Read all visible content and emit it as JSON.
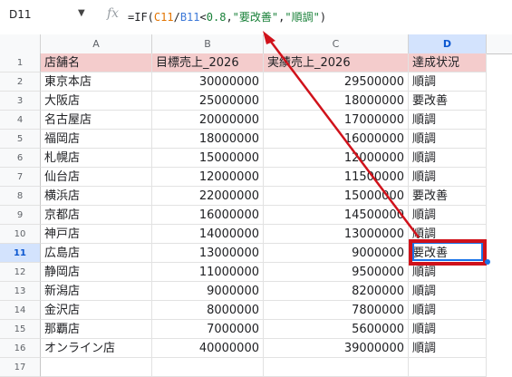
{
  "formula_bar": {
    "name_box": "D11",
    "fx": "fx",
    "f_eq": "=IF(",
    "f_ref1": "C11",
    "f_slash": "/",
    "f_ref2": "B11",
    "f_lt": "<",
    "f_num": "0.8",
    "f_c1": ",",
    "f_str1": "\"要改善\"",
    "f_c2": ",",
    "f_str2": "\"順調\"",
    "f_end": ")"
  },
  "columns": [
    "A",
    "B",
    "C",
    "D"
  ],
  "headers": [
    "店舗名",
    "目標売上_2026",
    "実績売上_2026",
    "達成状況"
  ],
  "rows": [
    {
      "n": "2",
      "store": "東京本店",
      "target": "30000000",
      "actual": "29500000",
      "status": "順調"
    },
    {
      "n": "3",
      "store": "大阪店",
      "target": "25000000",
      "actual": "18000000",
      "status": "要改善"
    },
    {
      "n": "4",
      "store": "名古屋店",
      "target": "20000000",
      "actual": "17000000",
      "status": "順調"
    },
    {
      "n": "5",
      "store": "福岡店",
      "target": "18000000",
      "actual": "16000000",
      "status": "順調"
    },
    {
      "n": "6",
      "store": "札幌店",
      "target": "15000000",
      "actual": "12000000",
      "status": "順調"
    },
    {
      "n": "7",
      "store": "仙台店",
      "target": "12000000",
      "actual": "11500000",
      "status": "順調"
    },
    {
      "n": "8",
      "store": "横浜店",
      "target": "22000000",
      "actual": "15000000",
      "status": "要改善"
    },
    {
      "n": "9",
      "store": "京都店",
      "target": "16000000",
      "actual": "14500000",
      "status": "順調"
    },
    {
      "n": "10",
      "store": "神戸店",
      "target": "14000000",
      "actual": "13000000",
      "status": "順調"
    },
    {
      "n": "11",
      "store": "広島店",
      "target": "13000000",
      "actual": "9000000",
      "status": "要改善"
    },
    {
      "n": "12",
      "store": "静岡店",
      "target": "11000000",
      "actual": "9500000",
      "status": "順調"
    },
    {
      "n": "13",
      "store": "新潟店",
      "target": "9000000",
      "actual": "8200000",
      "status": "順調"
    },
    {
      "n": "14",
      "store": "金沢店",
      "target": "8000000",
      "actual": "7800000",
      "status": "順調"
    },
    {
      "n": "15",
      "store": "那覇店",
      "target": "7000000",
      "actual": "5600000",
      "status": "順調"
    },
    {
      "n": "16",
      "store": "オンライン店",
      "target": "40000000",
      "actual": "39000000",
      "status": "順調"
    }
  ],
  "row_numbers": {
    "header": "1",
    "empty": "17"
  },
  "colors": {
    "header_fill": "#f4cccc",
    "highlight": "#d0121b",
    "selection": "#1a73e8"
  }
}
